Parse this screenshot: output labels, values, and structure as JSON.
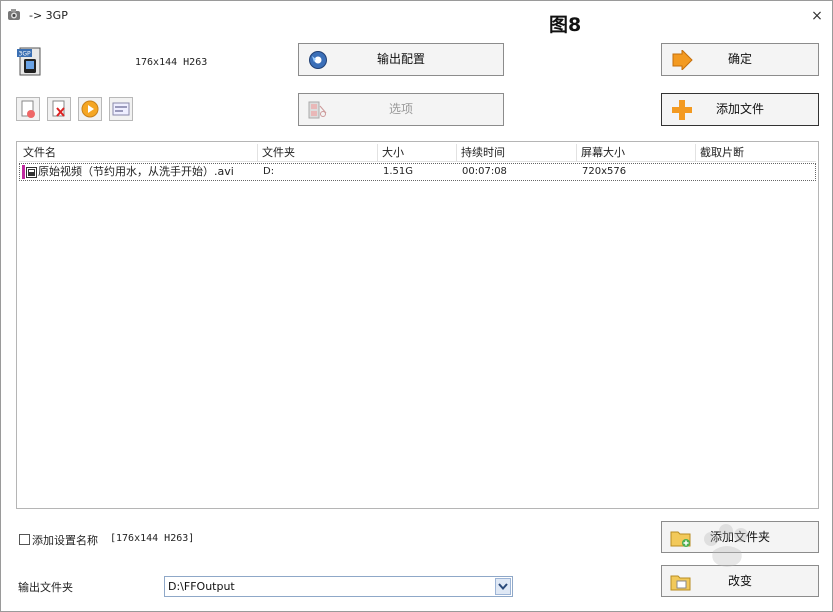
{
  "window": {
    "title": "-> 3GP",
    "figure_label": "图8",
    "close_glyph": "×"
  },
  "profile": {
    "label": "176x144 H263",
    "icon": "3gp-file-icon"
  },
  "buttons": {
    "output_config": "输出配置",
    "options": "选项",
    "confirm": "确定",
    "add_file": "添加文件",
    "add_folder": "添加文件夹",
    "change": "改变"
  },
  "toolbar": {
    "icons": [
      "remove-file-icon",
      "delete-file-icon",
      "play-icon",
      "info-icon"
    ]
  },
  "file_list": {
    "columns": [
      "文件名",
      "文件夹",
      "大小",
      "持续时间",
      "屏幕大小",
      "截取片断"
    ],
    "rows": [
      {
        "name": "原始视频（节约用水，从洗手开始）.avi",
        "folder": "D:",
        "size": "1.51G",
        "duration": "00:07:08",
        "screen_size": "720x576",
        "clip": ""
      }
    ]
  },
  "options": {
    "add_setting_name_label": "添加设置名称",
    "add_setting_name_checked": false,
    "profile_suffix": "[176x144 H263]"
  },
  "output": {
    "label": "输出文件夹",
    "folder": "D:\\FFOutput"
  },
  "colors": {
    "accent_orange": "#f39a21",
    "row_marker": "#c02aa0",
    "select_border": "#8fa8c8"
  }
}
